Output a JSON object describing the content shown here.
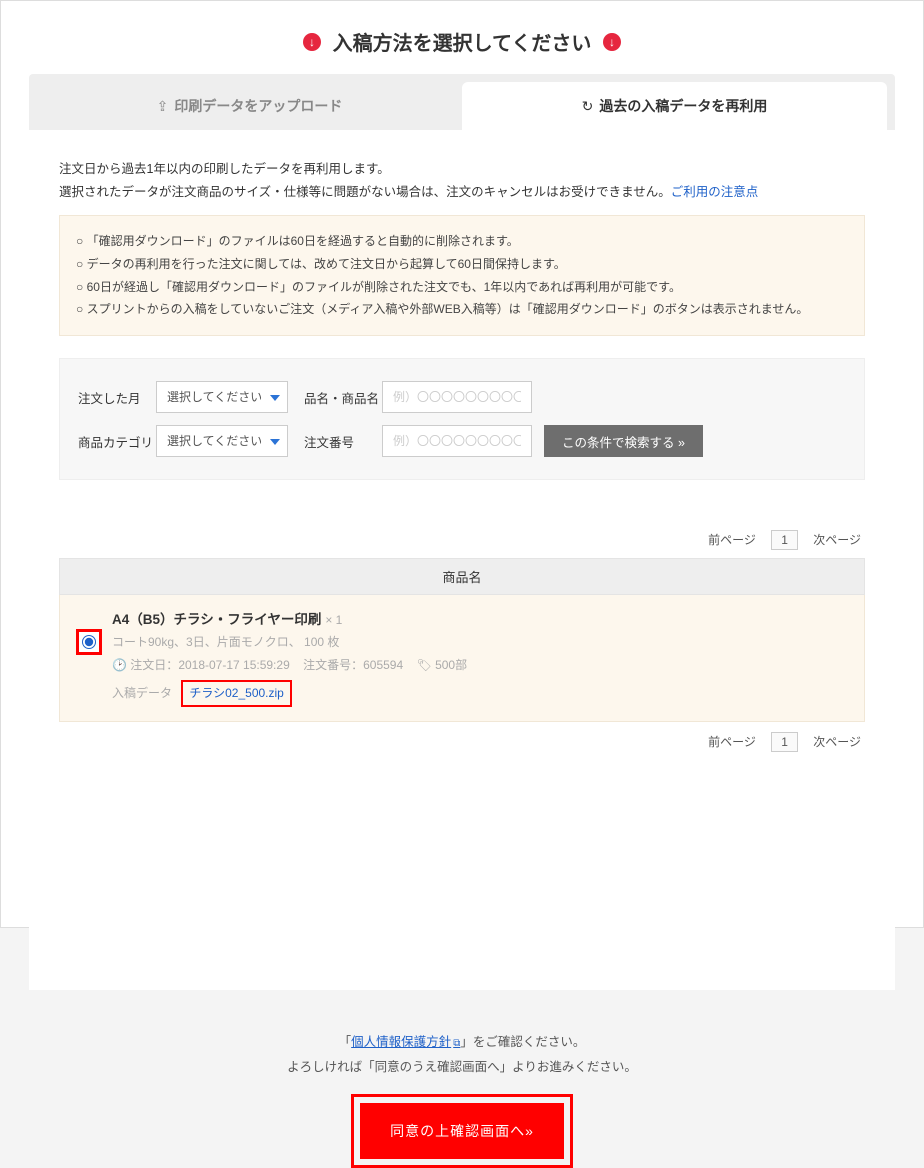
{
  "title": "入稿方法を選択してください",
  "tabs": {
    "upload": "印刷データをアップロード",
    "reuse": "過去の入稿データを再利用"
  },
  "intro": {
    "line1": "注文日から過去1年以内の印刷したデータを再利用します。",
    "line2_pre": "選択されたデータが注文商品のサイズ・仕様等に問題がない場合は、注文のキャンセルはお受けできません。",
    "link": "ご利用の注意点"
  },
  "notes": [
    "「確認用ダウンロード」のファイルは60日を経過すると自動的に削除されます。",
    "データの再利用を行った注文に関しては、改めて注文日から起算して60日間保持します。",
    "60日が経過し「確認用ダウンロード」のファイルが削除された注文でも、1年以内であれば再利用が可能です。",
    "スプリントからの入稿をしていないご注文（メディア入稿や外部WEB入稿等）は「確認用ダウンロード」のボタンは表示されません。"
  ],
  "search": {
    "month_label": "注文した月",
    "month_placeholder": "選択してください",
    "name_label": "品名・商品名",
    "name_placeholder": "例）〇〇〇〇〇〇〇〇〇〇",
    "category_label": "商品カテゴリ",
    "category_placeholder": "選択してください",
    "orderno_label": "注文番号",
    "orderno_placeholder": "例）〇〇〇〇〇〇〇〇〇〇",
    "button": "この条件で検索する »"
  },
  "pager": {
    "prev": "前ページ",
    "page": "1",
    "next": "次ページ"
  },
  "table": {
    "header": "商品名"
  },
  "item": {
    "name": "A4（B5）チラシ・フライヤー印刷",
    "qty": "× 1",
    "spec": "コート90kg、3日、片面モノクロ、 100 枚",
    "meta_date_label": "注文日：",
    "meta_date": "2018-07-17 15:59:29",
    "meta_orderno_label": "注文番号：",
    "meta_orderno": "605594",
    "meta_copies": "500部",
    "dl_label": "入稿データ",
    "dl_file": "チラシ02_500.zip"
  },
  "footer": {
    "privacy_pre": "「",
    "privacy_link": "個人情報保護方針",
    "privacy_post": "」をご確認ください。",
    "line2": "よろしければ「同意のうえ確認画面へ」よりお進みください。",
    "button": "同意の上確認画面へ»"
  }
}
